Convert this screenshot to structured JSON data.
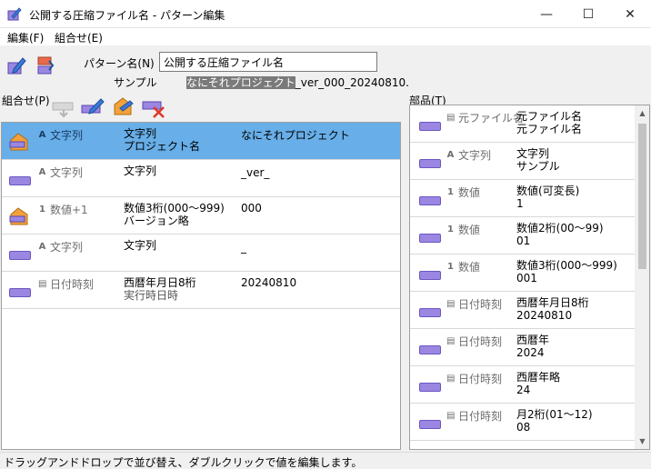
{
  "window": {
    "title": "公開する圧縮ファイル名 - パターン編集",
    "minimize": "—",
    "maximize": "☐",
    "close": "✕"
  },
  "menu": {
    "edit": "編集(F)",
    "combine": "組合せ(E)"
  },
  "form": {
    "pattern_label": "パターン名(N)",
    "pattern_value": "公開する圧縮ファイル名",
    "sample_label": "サンプル",
    "sample_highlight": "なにそれプロジェクト",
    "sample_rest": "_ver_000_20240810."
  },
  "combo_label": "組合せ(P)",
  "parts_label": "部品(T)",
  "combo_rows": [
    {
      "icon": "A",
      "kind": "文字列",
      "line1": "文字列",
      "line2": "プロジェクト名",
      "value": "なにそれプロジェクト"
    },
    {
      "icon": "A",
      "kind": "文字列",
      "line1": "文字列",
      "line2": "",
      "value": "_ver_"
    },
    {
      "icon": "1",
      "kind": "数値+1",
      "line1": "数値3桁(000～999)",
      "line2": "バージョン略",
      "value": "000"
    },
    {
      "icon": "A",
      "kind": "文字列",
      "line1": "文字列",
      "line2": "",
      "value": "_"
    },
    {
      "icon": "▤",
      "kind": "日付時刻",
      "line1": "西暦年月日8桁",
      "line2": "実行時日時",
      "value": "20240810"
    }
  ],
  "parts_rows": [
    {
      "icon": "▤",
      "kind": "元ファイル名",
      "line1": "元ファイル名",
      "line2": "元ファイル名"
    },
    {
      "icon": "A",
      "kind": "文字列",
      "line1": "文字列",
      "line2": "サンプル"
    },
    {
      "icon": "1",
      "kind": "数値",
      "line1": "数値(可変長)",
      "line2": "1"
    },
    {
      "icon": "1",
      "kind": "数値",
      "line1": "数値2桁(00～99)",
      "line2": "01"
    },
    {
      "icon": "1",
      "kind": "数値",
      "line1": "数値3桁(000～999)",
      "line2": "001"
    },
    {
      "icon": "▤",
      "kind": "日付時刻",
      "line1": "西暦年月日8桁",
      "line2": "20240810"
    },
    {
      "icon": "▤",
      "kind": "日付時刻",
      "line1": "西暦年",
      "line2": "2024"
    },
    {
      "icon": "▤",
      "kind": "日付時刻",
      "line1": "西暦年略",
      "line2": "24"
    },
    {
      "icon": "▤",
      "kind": "日付時刻",
      "line1": "月2桁(01～12)",
      "line2": "08"
    }
  ],
  "status": "ドラッグアンドドロップで並び替え、ダブルクリックで値を編集します。",
  "colors": {
    "selected_row": "#68aee8",
    "part_tag": "#9b86e2",
    "edit_tag": "#f2a23a"
  }
}
